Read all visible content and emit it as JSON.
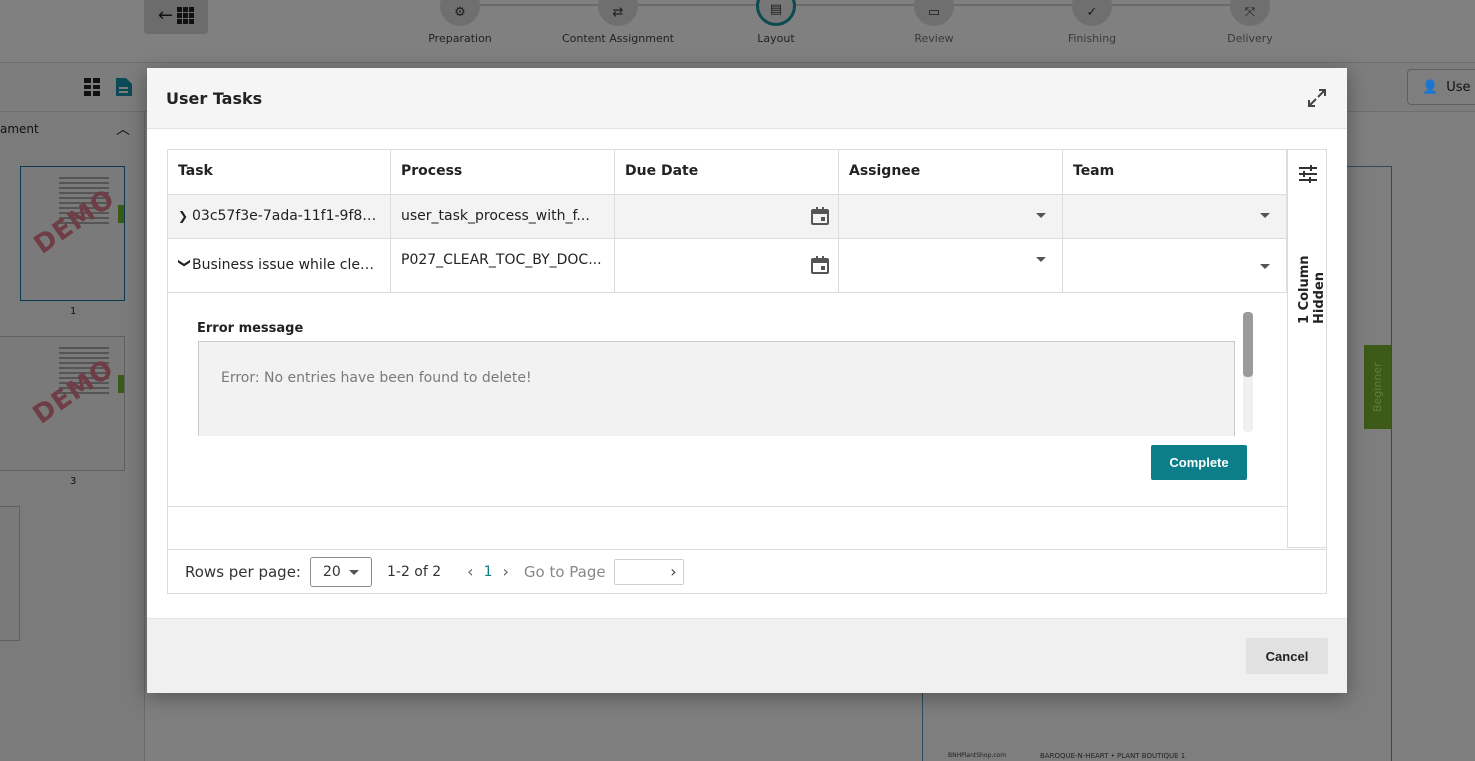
{
  "background": {
    "steps": [
      {
        "label": "Preparation",
        "icon": "gear-icon"
      },
      {
        "label": "Content Assignment",
        "icon": "swap-arrows-icon"
      },
      {
        "label": "Layout",
        "icon": "layout-icon"
      },
      {
        "label": "Review",
        "icon": "comment-icon"
      },
      {
        "label": "Finishing",
        "icon": "check-icon"
      },
      {
        "label": "Delivery",
        "icon": "merge-icon"
      }
    ],
    "side_panel_label": "ament",
    "user_button_label": "Use",
    "thumbnail_numbers": [
      "1",
      "3"
    ],
    "beginner_tag": "Beginner",
    "footer_text": "BAROQUE-N-HEART • PLANT BOUTIQUE   1",
    "footer_small": "BNHPlantShop.com",
    "watermark": "DEMO"
  },
  "modal": {
    "title": "User Tasks",
    "table": {
      "columns": [
        "Task",
        "Process",
        "Due Date",
        "Assignee",
        "Team"
      ],
      "rows": [
        {
          "expanded": false,
          "task": "03c57f3e-7ada-11f1-9f8d-0...",
          "process": "user_task_process_with_f...",
          "due_date": "",
          "assignee": "",
          "team": ""
        },
        {
          "expanded": true,
          "task": "Business issue while cleari...",
          "process": "P027_CLEAR_TOC_BY_DOC...",
          "due_date": "",
          "assignee": "",
          "team": ""
        }
      ],
      "detail": {
        "label": "Error message",
        "message": "Error: No entries have been found to delete!",
        "complete_label": "Complete"
      },
      "hidden_columns_label": "1 Column Hidden"
    },
    "pagination": {
      "rows_per_page_label": "Rows per page:",
      "rows_per_page_value": "20",
      "range": "1-2 of 2",
      "current_page": "1",
      "go_to_page_label": "Go to Page"
    },
    "cancel_label": "Cancel"
  },
  "colors": {
    "accent": "#0b7e8a",
    "overlay": "#7f7f7f"
  }
}
